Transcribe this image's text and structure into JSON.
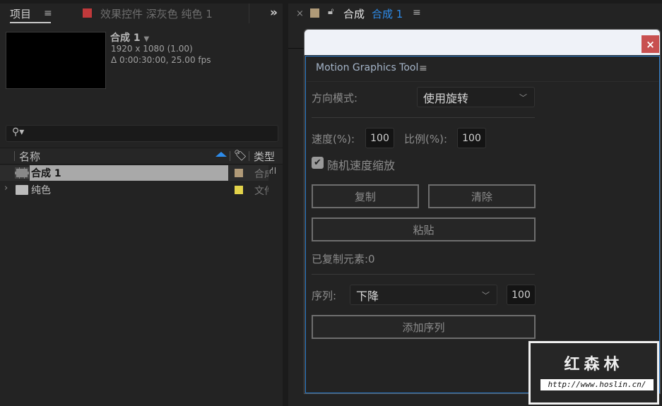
{
  "left_panel": {
    "tab_project": "项目",
    "tab_effects": "效果控件 深灰色 纯色 1",
    "overflow": "»",
    "preview": {
      "name": "合成 1",
      "resolution": "1920 x 1080 (1.00)",
      "duration": "Δ 0:00:30:00, 25.00 fps"
    },
    "columns": {
      "name": "名称",
      "type": "类型"
    },
    "items": [
      {
        "name": "合成 1",
        "type": "合成",
        "label_color": "#b09a78"
      },
      {
        "name": "纯色",
        "type": "文件",
        "label_color": "#e3d34a"
      }
    ]
  },
  "comp_tab": {
    "prefix": "合成",
    "name": "合成 1",
    "color": "#b09a78"
  },
  "dialog": {
    "close": "×",
    "title": "Motion Graphics Tool",
    "direction_label": "方向模式:",
    "direction_value": "使用旋转",
    "speed_label": "速度(%):",
    "speed_value": "100",
    "scale_label": "比例(%):",
    "scale_value": "100",
    "random_label": "随机速度缩放",
    "random_checked": true,
    "copy": "复制",
    "clear": "清除",
    "paste": "粘贴",
    "copied_count": "已复制元素:0",
    "sequence_label": "序列:",
    "sequence_value": "下降",
    "sequence_amount": "100",
    "add_sequence": "添加序列"
  },
  "watermark": {
    "title": "红森林",
    "url": "http://www.hoslin.cn/"
  }
}
